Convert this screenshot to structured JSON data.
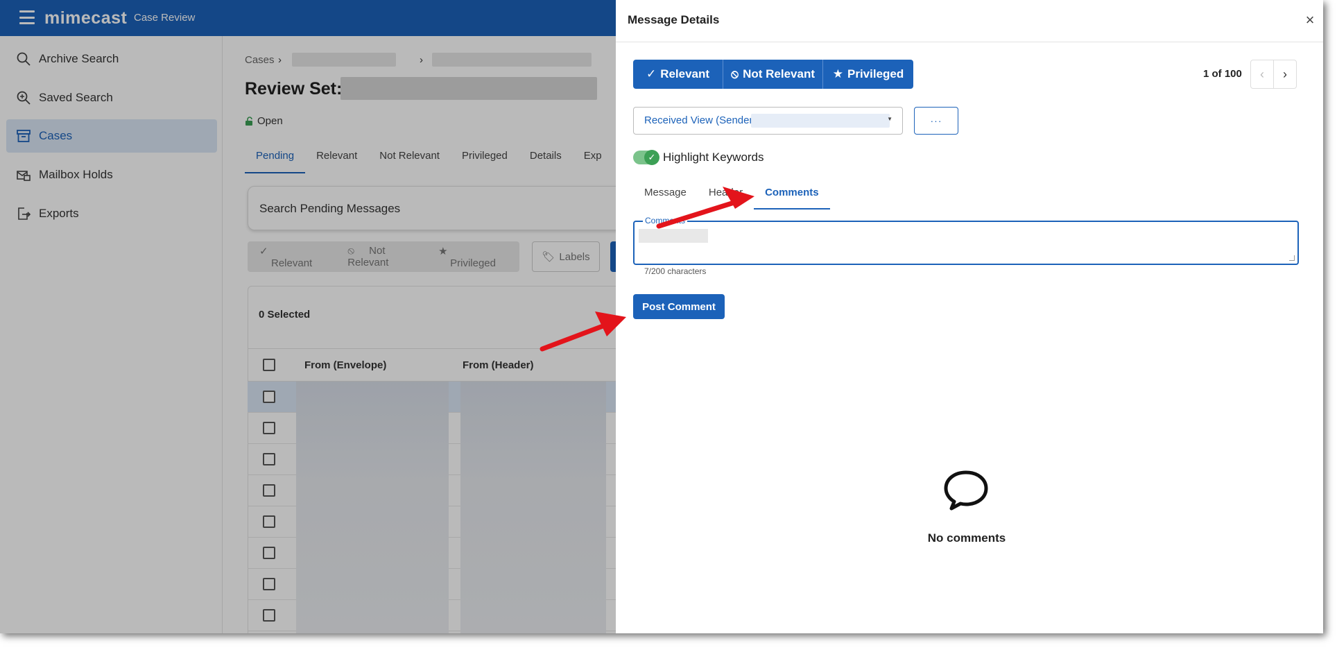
{
  "app": {
    "brand": "mimecast",
    "product": "Case Review"
  },
  "sidebar": {
    "items": [
      {
        "label": "Archive Search",
        "icon": "search-icon"
      },
      {
        "label": "Saved Search",
        "icon": "saved-search-icon"
      },
      {
        "label": "Cases",
        "icon": "archive-box-icon",
        "active": true
      },
      {
        "label": "Mailbox Holds",
        "icon": "mailbox-hold-icon"
      },
      {
        "label": "Exports",
        "icon": "export-icon"
      }
    ]
  },
  "main": {
    "breadcrumb_root": "Cases",
    "review_set_label": "Review Set:",
    "status": "Open",
    "tabs": [
      "Pending",
      "Relevant",
      "Not Relevant",
      "Privileged",
      "Details",
      "Exp"
    ],
    "search_placeholder": "Search Pending Messages",
    "bulk_actions": [
      "Relevant",
      "Not Relevant",
      "Privileged"
    ],
    "labels_button": "Labels",
    "selected_count": "0 Selected",
    "table": {
      "columns": [
        "From (Envelope)",
        "From (Header)"
      ]
    }
  },
  "drawer": {
    "title": "Message Details",
    "classify_buttons": [
      "Relevant",
      "Not Relevant",
      "Privileged"
    ],
    "pager": "1 of 100",
    "view_select": "Received View (Sender)",
    "more_label": "···",
    "highlight_keywords": "Highlight Keywords",
    "highlight_enabled": true,
    "tabs": [
      "Message",
      "Header",
      "Comments"
    ],
    "active_tab": "Comments",
    "comment_label": "Comments",
    "char_count": "7/200 characters",
    "post_button": "Post Comment",
    "empty_state": "No comments"
  },
  "colors": {
    "primary": "#1c62b9",
    "toggle_on": "#3ca055",
    "annotation_arrow": "#e3141b"
  }
}
